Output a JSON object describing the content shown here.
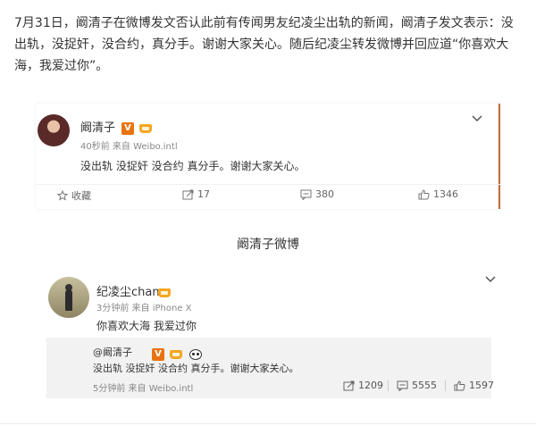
{
  "article": {
    "paragraph": "7月31日，阚清子在微博发文否认此前有传闻男友纪凌尘出轨的新闻，阚清子发文表示：没出轨，没捉奸，没合约，真分手。谢谢大家关心。随后纪凌尘转发微博并回应道“你喜欢大海，我爱过你”。"
  },
  "post1": {
    "username": "阚清子",
    "verified_badge": "V",
    "meta": "40秒前 来自 Weibo.intl",
    "text": "没出轨 没捉奸 没合约 真分手。谢谢大家关心。",
    "actions": {
      "favorite_label": "收藏",
      "repost_count": "17",
      "comment_count": "380",
      "like_count": "1346"
    }
  },
  "caption": "阚清子微博",
  "post2": {
    "username": "纪凌尘chan",
    "meta": "3分钟前 来自 iPhone X",
    "text": "你喜欢大海 我爱过你",
    "repost": {
      "who": "@阚清子",
      "verified_badge": "V",
      "text": "没出轨 没捉奸 没合约 真分手。谢谢大家关心。",
      "meta": "5分钟前 来自 Weibo.intl",
      "repost_count": "1209",
      "comment_count": "5555",
      "like_count": "1597"
    }
  },
  "colors": {
    "vip_orange": "#e8730f",
    "crown_gold": "#f5a623",
    "repost_bg": "#f2f2f2"
  },
  "icons": [
    "star-icon",
    "repost-icon",
    "comment-icon",
    "like-icon",
    "chevron-down-icon",
    "vip-badge-icon",
    "crown-icon",
    "panda-icon"
  ]
}
